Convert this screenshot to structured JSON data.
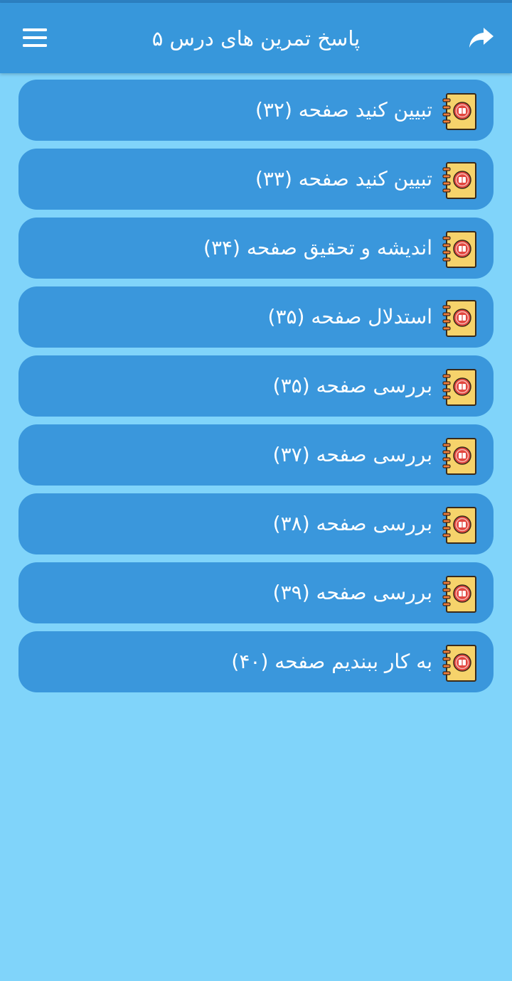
{
  "app_bar": {
    "title": "پاسخ تمرین های درس ۵",
    "menu_icon": "hamburger-menu-icon",
    "share_icon": "share-arrow-icon"
  },
  "items": [
    {
      "label": "تبیین کنید صفحه (۳۲)",
      "icon": "notebook-icon"
    },
    {
      "label": "تبیین کنید صفحه (۳۳)",
      "icon": "notebook-icon"
    },
    {
      "label": "اندیشه و تحقیق صفحه (۳۴)",
      "icon": "notebook-icon"
    },
    {
      "label": "استدلال صفحه (۳۵)",
      "icon": "notebook-icon"
    },
    {
      "label": "بررسی صفحه (۳۵)",
      "icon": "notebook-icon"
    },
    {
      "label": "بررسی صفحه (۳۷)",
      "icon": "notebook-icon"
    },
    {
      "label": "بررسی صفحه (۳۸)",
      "icon": "notebook-icon"
    },
    {
      "label": "بررسی صفحه (۳۹)",
      "icon": "notebook-icon"
    },
    {
      "label": "به کار ببندیم صفحه (۴۰)",
      "icon": "notebook-icon"
    }
  ],
  "colors": {
    "background": "#80d4fa",
    "app_bar": "#3797db",
    "list_item": "#3a97dc",
    "text": "#ffffff",
    "notebook_cover": "#f6d36b",
    "notebook_badge": "#e1463f"
  }
}
